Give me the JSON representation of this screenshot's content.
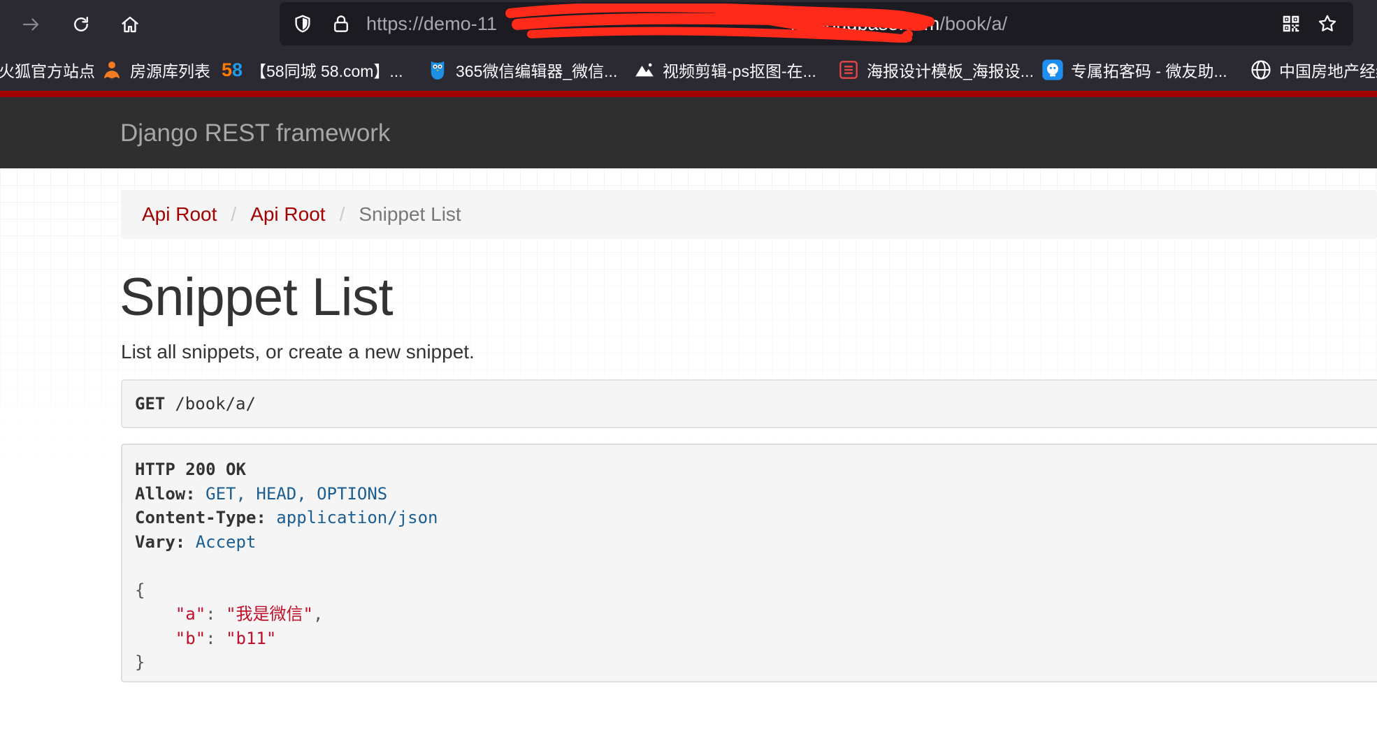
{
  "browser": {
    "url_visible_start": "https://demo-11",
    "url_visible_host_end": "n.tcloudbase.com",
    "url_visible_path": "/book/a/",
    "bookmarks": [
      {
        "label": "火狐官方站点",
        "icon": "firefox-icon"
      },
      {
        "label": "房源库列表",
        "icon": "person-orange-icon"
      },
      {
        "label": "【58同城 58.com】...",
        "icon": "58-logo-icon"
      },
      {
        "label": "365微信编辑器_微信...",
        "icon": "owl-icon"
      },
      {
        "label": "视频剪辑-ps抠图-在...",
        "icon": "mountain-icon"
      },
      {
        "label": "海报设计模板_海报设...",
        "icon": "poster-icon"
      },
      {
        "label": "专属拓客码 - 微友助...",
        "icon": "blue-bot-icon"
      },
      {
        "label": "中国房地产经纪",
        "icon": "globe-icon"
      }
    ]
  },
  "navbar": {
    "brand": "Django REST framework"
  },
  "breadcrumb": {
    "items": [
      "Api Root",
      "Api Root"
    ],
    "active": "Snippet List"
  },
  "page": {
    "title": "Snippet List",
    "description": "List all snippets, or create a new snippet."
  },
  "request": {
    "method": "GET",
    "path": "/book/a/"
  },
  "response": {
    "status": "HTTP 200 OK",
    "headers": [
      {
        "name": "Allow:",
        "value": "GET, HEAD, OPTIONS"
      },
      {
        "name": "Content-Type:",
        "value": "application/json"
      },
      {
        "name": "Vary:",
        "value": "Accept"
      }
    ],
    "body": {
      "open": "{",
      "close": "}",
      "entries": [
        {
          "key": "\"a\"",
          "value": "\"我是微信\"",
          "trail": ","
        },
        {
          "key": "\"b\"",
          "value": "\"b11\"",
          "trail": ""
        }
      ]
    }
  },
  "colors": {
    "navbar_accent": "#a30000",
    "link": "#a30000",
    "header_value": "#1c5e91",
    "json_string": "#c0102b"
  }
}
